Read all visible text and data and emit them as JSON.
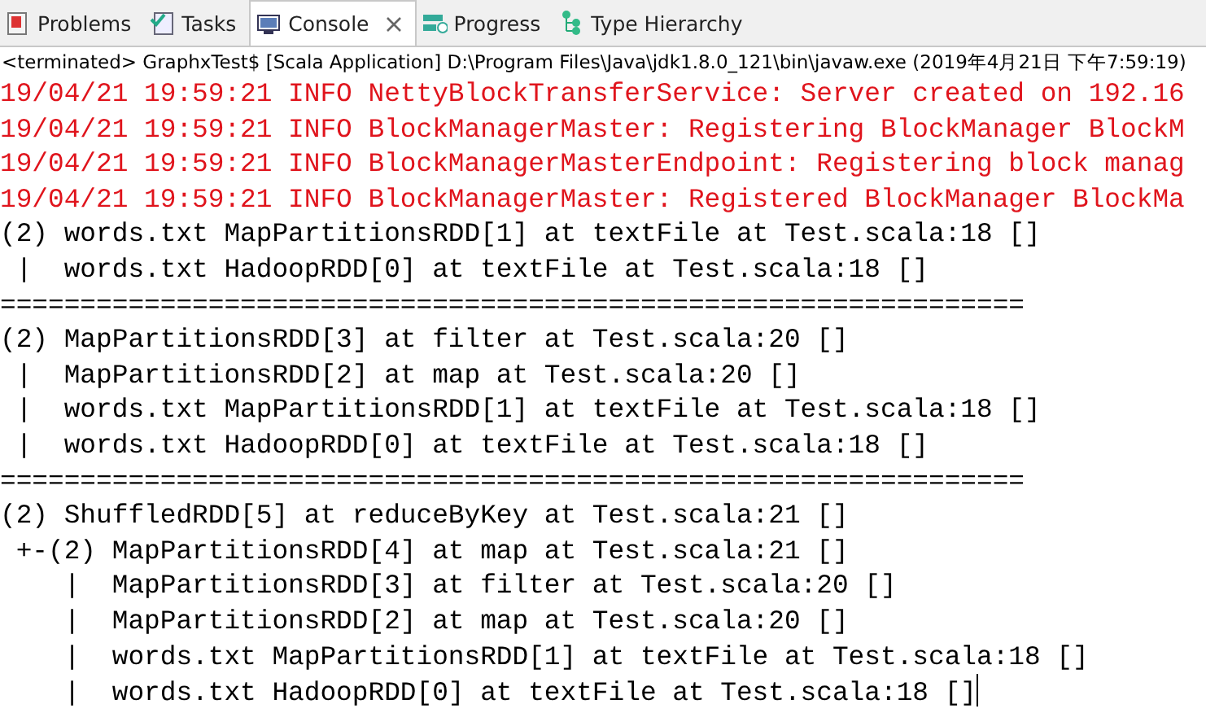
{
  "tabs": [
    {
      "label": "Problems",
      "selected": false,
      "closable": false
    },
    {
      "label": "Tasks",
      "selected": false,
      "closable": false
    },
    {
      "label": "Console",
      "selected": true,
      "closable": true
    },
    {
      "label": "Progress",
      "selected": false,
      "closable": false
    },
    {
      "label": "Type Hierarchy",
      "selected": false,
      "closable": false
    }
  ],
  "console": {
    "header": "<terminated> GraphxTest$ [Scala Application] D:\\Program Files\\Java\\jdk1.8.0_121\\bin\\javaw.exe (2019年4月21日 下午7:59:19)",
    "lines": [
      {
        "kind": "error",
        "text": "19/04/21 19:59:21 INFO NettyBlockTransferService: Server created on 192.16"
      },
      {
        "kind": "error",
        "text": "19/04/21 19:59:21 INFO BlockManagerMaster: Registering BlockManager BlockM"
      },
      {
        "kind": "error",
        "text": "19/04/21 19:59:21 INFO BlockManagerMasterEndpoint: Registering block manag"
      },
      {
        "kind": "error",
        "text": "19/04/21 19:59:21 INFO BlockManagerMaster: Registered BlockManager BlockMa"
      },
      {
        "kind": "output",
        "text": "(2) words.txt MapPartitionsRDD[1] at textFile at Test.scala:18 []"
      },
      {
        "kind": "output",
        "text": " |  words.txt HadoopRDD[0] at textFile at Test.scala:18 []"
      },
      {
        "kind": "output",
        "text": "================================================================"
      },
      {
        "kind": "output",
        "text": "(2) MapPartitionsRDD[3] at filter at Test.scala:20 []"
      },
      {
        "kind": "output",
        "text": " |  MapPartitionsRDD[2] at map at Test.scala:20 []"
      },
      {
        "kind": "output",
        "text": " |  words.txt MapPartitionsRDD[1] at textFile at Test.scala:18 []"
      },
      {
        "kind": "output",
        "text": " |  words.txt HadoopRDD[0] at textFile at Test.scala:18 []"
      },
      {
        "kind": "output",
        "text": "================================================================"
      },
      {
        "kind": "output",
        "text": "(2) ShuffledRDD[5] at reduceByKey at Test.scala:21 []"
      },
      {
        "kind": "output",
        "text": " +-(2) MapPartitionsRDD[4] at map at Test.scala:21 []"
      },
      {
        "kind": "output",
        "text": "    |  MapPartitionsRDD[3] at filter at Test.scala:20 []"
      },
      {
        "kind": "output",
        "text": "    |  MapPartitionsRDD[2] at map at Test.scala:20 []"
      },
      {
        "kind": "output",
        "text": "    |  words.txt MapPartitionsRDD[1] at textFile at Test.scala:18 []"
      },
      {
        "kind": "output",
        "text": "    |  words.txt HadoopRDD[0] at textFile at Test.scala:18 []"
      }
    ],
    "cursor_at_end": true
  }
}
